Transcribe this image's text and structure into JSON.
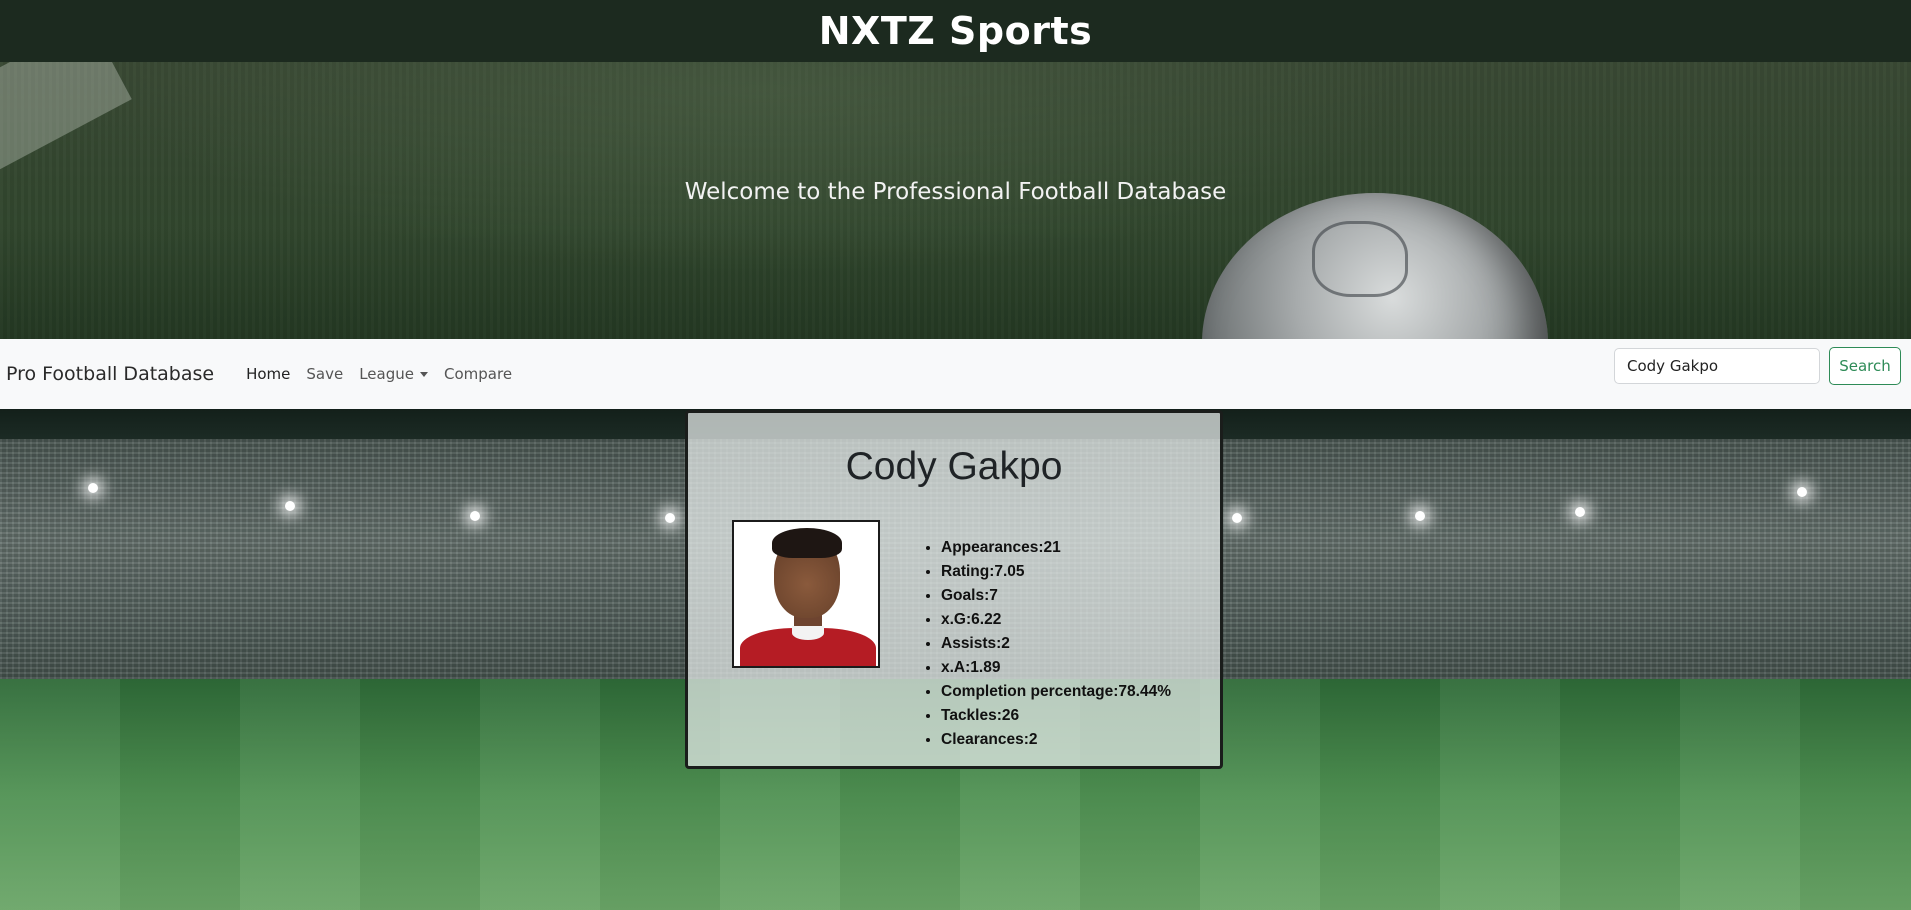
{
  "header": {
    "title": "NXTZ Sports"
  },
  "hero": {
    "welcome_text": "Welcome to the Professional Football Database"
  },
  "navbar": {
    "brand": "Pro Football Database",
    "links": [
      {
        "label": "Home"
      },
      {
        "label": "Save"
      },
      {
        "label": "League"
      },
      {
        "label": "Compare"
      }
    ],
    "search": {
      "value": "Cody Gakpo",
      "button_label": "Search"
    }
  },
  "player": {
    "name": "Cody Gakpo",
    "stats": [
      "Appearances:21",
      "Rating:7.05",
      "Goals:7",
      "x.G:6.22",
      "Assists:2",
      "x.A:1.89",
      "Completion percentage:78.44%",
      "Tackles:26",
      "Clearances:2"
    ]
  },
  "colors": {
    "header_bg": "#1c2a1f",
    "navbar_bg": "#f8f9fa",
    "search_button": "#2e8b57",
    "jersey": "#b51c24"
  },
  "icons": {
    "league_dropdown": "caret-down-icon"
  }
}
